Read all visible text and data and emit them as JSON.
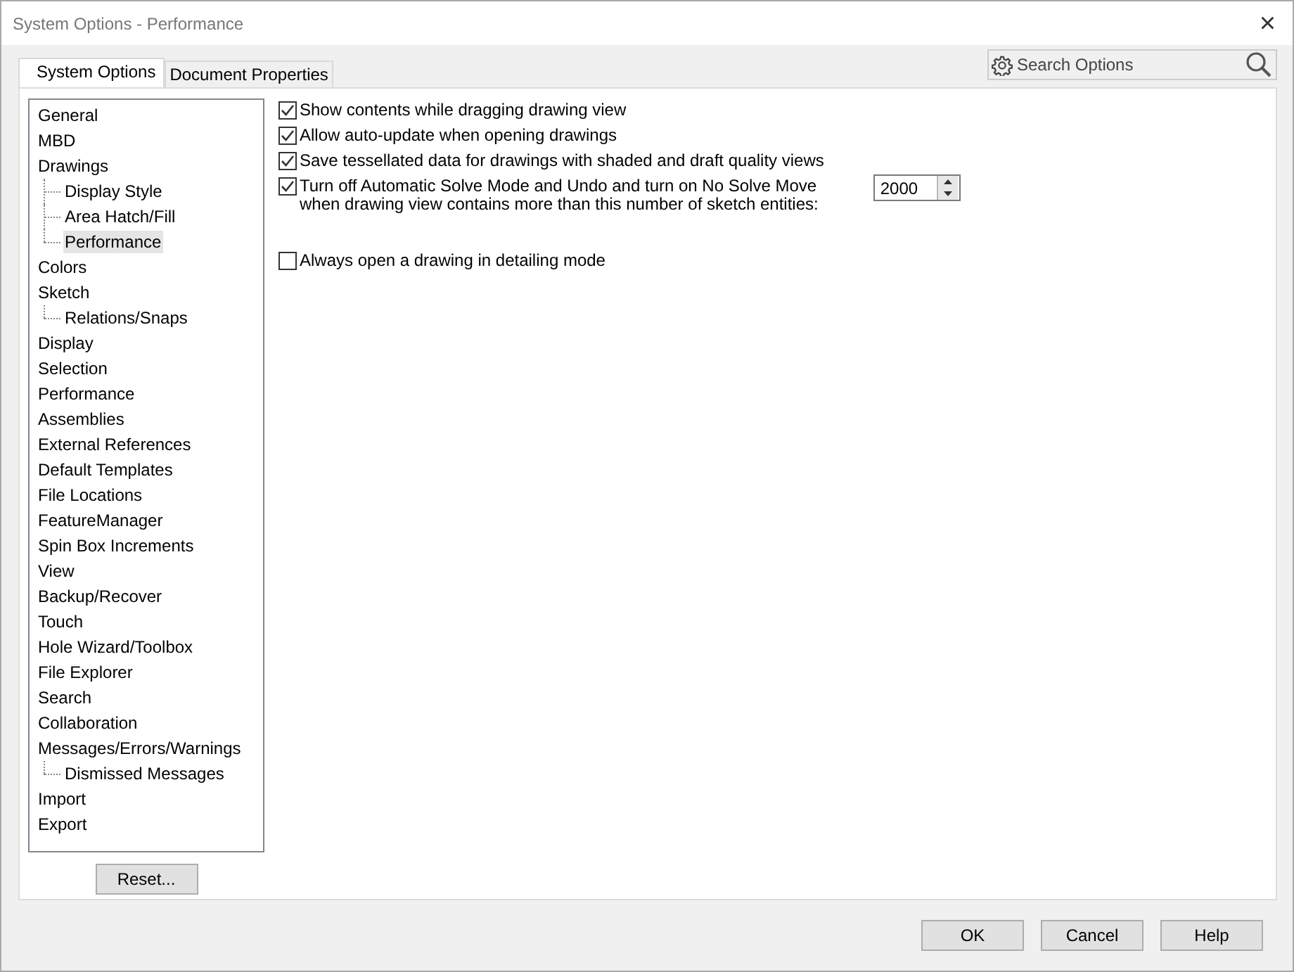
{
  "window": {
    "title": "System Options - Performance",
    "close": "×"
  },
  "tabs": [
    {
      "label": "System Options",
      "selected": true
    },
    {
      "label": "Document Properties",
      "selected": false
    }
  ],
  "search": {
    "placeholder": "Search Options"
  },
  "tree": {
    "items": [
      {
        "label": "General",
        "selected": false
      },
      {
        "label": "MBD",
        "selected": false
      },
      {
        "label": "Drawings",
        "selected": false,
        "children": [
          {
            "label": "Display Style",
            "selected": false
          },
          {
            "label": "Area Hatch/Fill",
            "selected": false
          },
          {
            "label": "Performance",
            "selected": true
          }
        ]
      },
      {
        "label": "Colors",
        "selected": false
      },
      {
        "label": "Sketch",
        "selected": false,
        "children": [
          {
            "label": "Relations/Snaps",
            "selected": false
          }
        ]
      },
      {
        "label": "Display",
        "selected": false
      },
      {
        "label": "Selection",
        "selected": false
      },
      {
        "label": "Performance",
        "selected": false
      },
      {
        "label": "Assemblies",
        "selected": false
      },
      {
        "label": "External References",
        "selected": false
      },
      {
        "label": "Default Templates",
        "selected": false
      },
      {
        "label": "File Locations",
        "selected": false
      },
      {
        "label": "FeatureManager",
        "selected": false
      },
      {
        "label": "Spin Box Increments",
        "selected": false
      },
      {
        "label": "View",
        "selected": false
      },
      {
        "label": "Backup/Recover",
        "selected": false
      },
      {
        "label": "Touch",
        "selected": false
      },
      {
        "label": "Hole Wizard/Toolbox",
        "selected": false
      },
      {
        "label": "File Explorer",
        "selected": false
      },
      {
        "label": "Search",
        "selected": false
      },
      {
        "label": "Collaboration",
        "selected": false
      },
      {
        "label": "Messages/Errors/Warnings",
        "selected": false,
        "children": [
          {
            "label": "Dismissed Messages",
            "selected": false
          }
        ]
      },
      {
        "label": "Import",
        "selected": false
      },
      {
        "label": "Export",
        "selected": false
      }
    ]
  },
  "reset_button": "Reset...",
  "options": [
    {
      "kind": "checkbox",
      "label": "Show contents while dragging drawing view",
      "checked": true
    },
    {
      "kind": "checkbox",
      "label": "Allow auto-update when opening drawings",
      "checked": true
    },
    {
      "kind": "checkbox",
      "label": "Save tessellated data for drawings with shaded and draft quality views",
      "checked": true
    },
    {
      "kind": "number",
      "label": "Turn off Automatic Solve Mode and Undo and turn on No Solve Move\nwhen drawing view contains more than this number of sketch entities:",
      "checked": true,
      "value": "2000"
    },
    {
      "kind": "checkbox",
      "label": "Always open a drawing in detailing mode",
      "checked": false
    }
  ],
  "buttons": [
    "OK",
    "Cancel",
    "Help"
  ]
}
